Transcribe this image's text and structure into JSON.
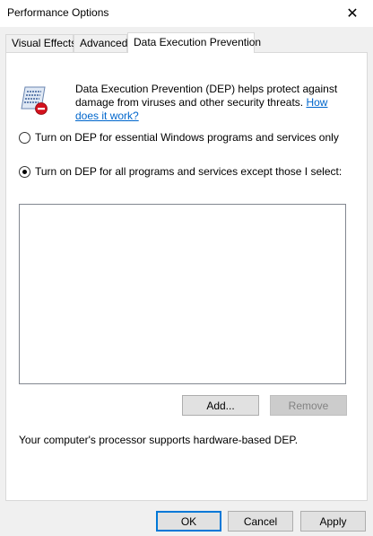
{
  "window": {
    "title": "Performance Options",
    "close_glyph": "✕"
  },
  "tabs": [
    {
      "label": "Visual Effects",
      "active": false
    },
    {
      "label": "Advanced",
      "active": false
    },
    {
      "label": "Data Execution Prevention",
      "active": true
    }
  ],
  "dep": {
    "icon": "dep-shield-icon",
    "description": "Data Execution Prevention (DEP) helps protect against damage from viruses and other security threats.",
    "help_link": "How does it work?",
    "options": [
      {
        "label": "Turn on DEP for essential Windows programs and services only",
        "selected": false
      },
      {
        "label": "Turn on DEP for all programs and services except those I select:",
        "selected": true
      }
    ],
    "exception_list": [],
    "add_label": "Add...",
    "remove_label": "Remove",
    "support_text": "Your computer's processor supports hardware-based DEP."
  },
  "footer": {
    "ok_label": "OK",
    "cancel_label": "Cancel",
    "apply_label": "Apply"
  },
  "colors": {
    "link": "#0066cc",
    "accent": "#0078d7",
    "dialog_bg": "#f0f0f0"
  }
}
